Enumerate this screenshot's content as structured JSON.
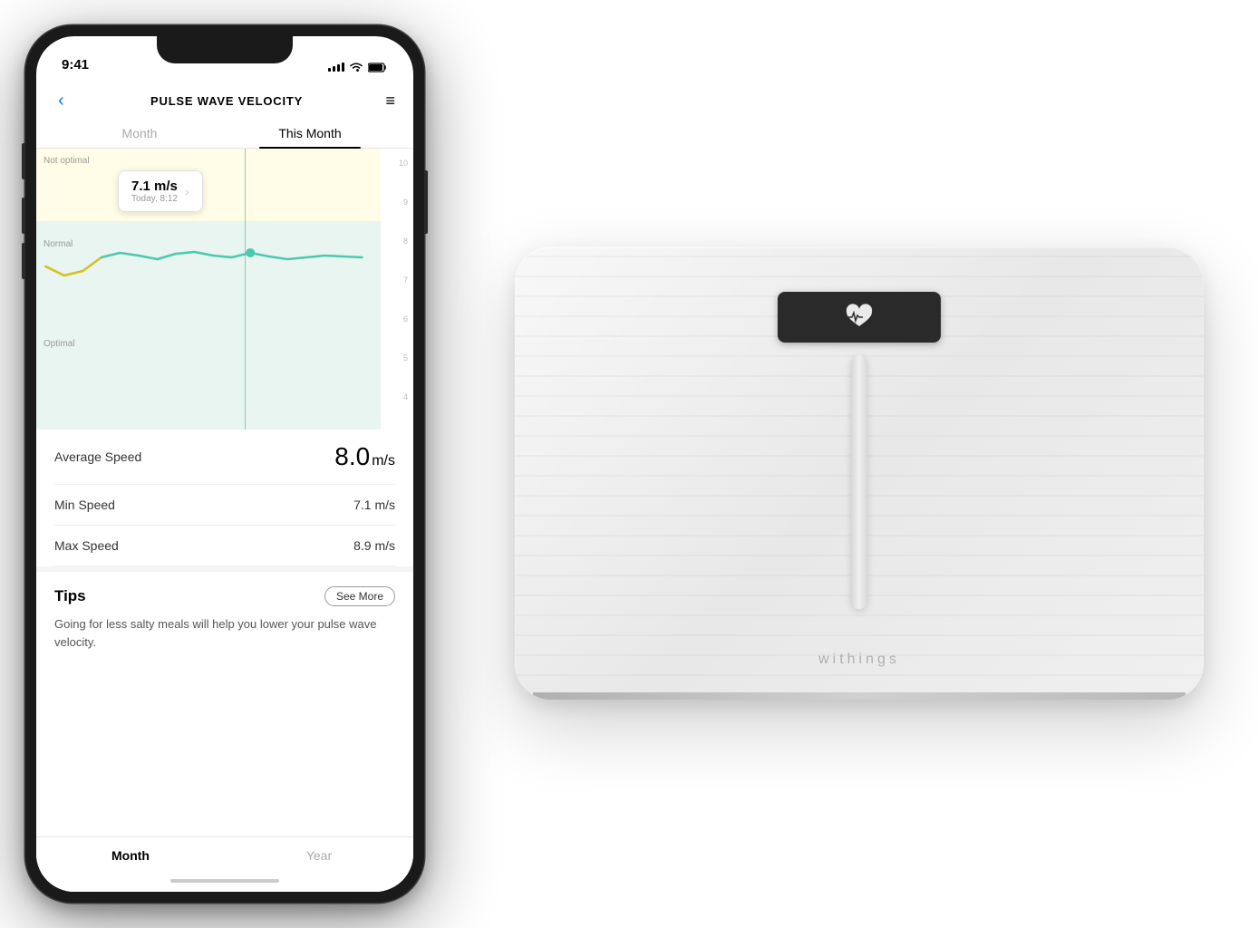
{
  "statusBar": {
    "time": "9:41",
    "signalBars": 4,
    "wifi": true,
    "battery": "full"
  },
  "nav": {
    "backLabel": "‹",
    "title": "PULSE WAVE VELOCITY",
    "menuIcon": "≡"
  },
  "tabs": {
    "month": "Month",
    "thisMonth": "This Month"
  },
  "chart": {
    "zones": {
      "notOptimal": "Not optimal",
      "normal": "Normal",
      "optimal": "Optimal"
    },
    "scale": [
      "10",
      "9",
      "8",
      "7",
      "6",
      "5",
      "4"
    ],
    "tooltip": {
      "value": "7.1 m/s",
      "date": "Today, 8:12"
    }
  },
  "stats": {
    "averageSpeed": {
      "label": "Average Speed",
      "value": "8.0",
      "unit": "m/s"
    },
    "minSpeed": {
      "label": "Min Speed",
      "value": "7.1 m/s"
    },
    "maxSpeed": {
      "label": "Max Speed",
      "value": "8.9 m/s"
    }
  },
  "tips": {
    "title": "Tips",
    "seeMoreLabel": "See More",
    "text": "Going for less salty meals will help you lower your pulse wave velocity."
  },
  "bottomTabs": {
    "month": "Month",
    "year": "Year"
  },
  "scale": {
    "brand": "withings"
  }
}
